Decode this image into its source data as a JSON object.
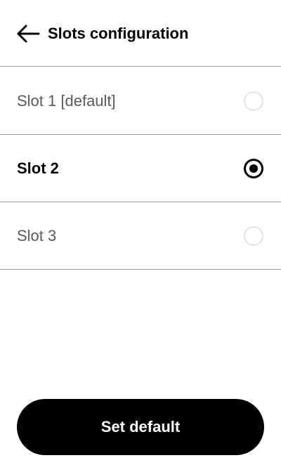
{
  "header": {
    "back_icon": "arrow-left-icon",
    "title": "Slots configuration"
  },
  "slots": [
    {
      "label": "Slot 1 [default]",
      "selected": false
    },
    {
      "label": "Slot 2",
      "selected": true
    },
    {
      "label": "Slot 3",
      "selected": false
    }
  ],
  "footer": {
    "set_default_label": "Set default"
  },
  "colors": {
    "accent": "#000000",
    "divider": "#9a9a9a",
    "unselected_text": "#5a5a5a",
    "unselected_radio": "#e2e2e2"
  }
}
